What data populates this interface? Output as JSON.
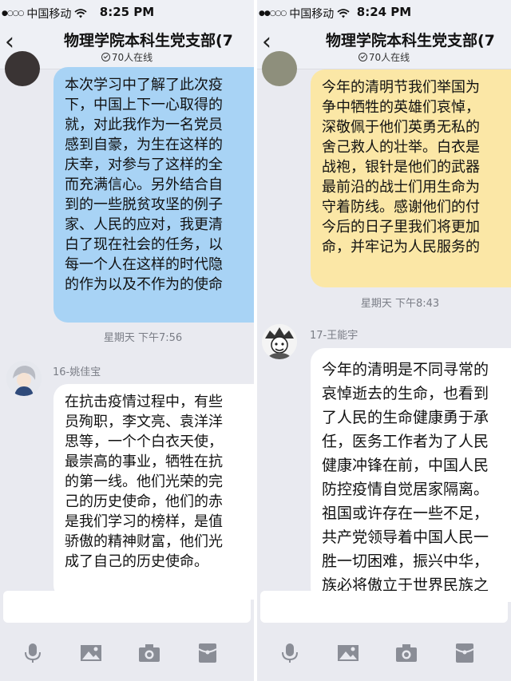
{
  "colors": {
    "chat_background": "#e9eaf0",
    "bubble_blue": "#a8d3f5",
    "bubble_yellow": "#fbe7a6",
    "bubble_white": "#ffffff",
    "timestamp_text": "#7a7d86",
    "icon_gray": "#8a8d96"
  },
  "left_panel": {
    "status": {
      "carrier": "中国移动",
      "time": "8:25 PM"
    },
    "header": {
      "back_icon": "chevron-left-icon",
      "title": "物理学院本科生党支部(7",
      "online_count": "70人在线"
    },
    "messages": [
      {
        "bubble_color": "blue",
        "lines": [
          "本次学习中了解了此次疫",
          "下，中国上下一心取得的",
          "就，对此我作为一名党员",
          "感到自豪，为生在这样的",
          "庆幸，对参与了这样的全",
          "而充满信心。另外结合自",
          "到的一些脱贫攻坚的例子",
          "家、人民的应对，我更清",
          "白了现在社会的任务，以",
          "每一个人在这样的时代隐",
          "的作为以及不作为的使命"
        ]
      },
      {
        "timestamp": "星期天 下午7:56"
      },
      {
        "sender": "16-姚佳宝",
        "bubble_color": "white",
        "lines": [
          "在抗击疫情过程中，有些",
          "员殉职，李文亮、袁洋洋",
          "思等，一个个白衣天使，",
          "最崇高的事业，牺牲在抗",
          "的第一线。他们光荣的完",
          "己的历史使命，他们的赤",
          "是我们学习的榜样，是值",
          "骄傲的精神财富，他们光",
          "成了自己的历史使命。"
        ]
      }
    ],
    "toolbar": [
      "microphone-icon",
      "image-icon",
      "camera-icon",
      "red-packet-icon"
    ]
  },
  "right_panel": {
    "status": {
      "carrier": "中国移动",
      "time": "8:24 PM"
    },
    "header": {
      "back_icon": "chevron-left-icon",
      "title": "物理学院本科生党支部(7",
      "online_count": "70人在线"
    },
    "messages": [
      {
        "bubble_color": "yellow",
        "lines": [
          "今年的清明节我们举国为",
          "争中牺牲的英雄们哀悼，",
          "深敬佩于他们英勇无私的",
          "舍己救人的壮举。白衣是",
          "战袍，银针是他们的武器",
          "最前沿的战士们用生命为",
          "守着防线。感谢他们的付",
          "今后的日子里我们将更加",
          "命，并牢记为人民服务的"
        ]
      },
      {
        "timestamp": "星期天 下午8:43"
      },
      {
        "sender": "17-王能宇",
        "bubble_color": "white",
        "lines": [
          "今年的清明是不同寻常的",
          "哀悼逝去的生命，也看到",
          "了人民的生命健康勇于承",
          "任，医务工作者为了人民",
          "健康冲锋在前，中国人民",
          "防控疫情自觉居家隔离。",
          "祖国或许存在一些不足，",
          "共产党领导着中国人民一",
          "胜一切困难，振兴中华，",
          "族必将傲立于世界民族之"
        ]
      }
    ],
    "toolbar": [
      "microphone-icon",
      "image-icon",
      "camera-icon",
      "red-packet-icon"
    ]
  }
}
